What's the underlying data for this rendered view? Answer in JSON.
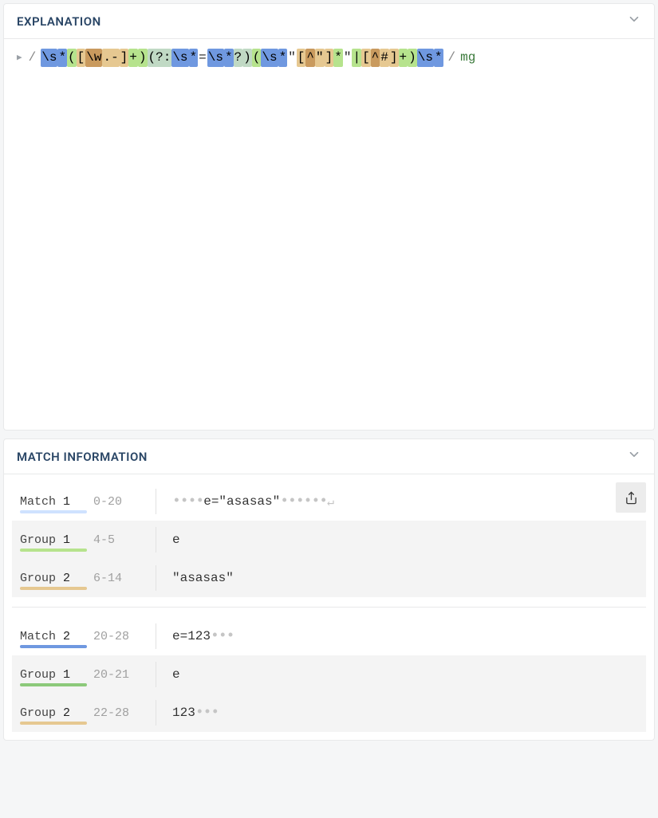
{
  "explanation": {
    "title": "EXPLANATION",
    "delimiter": "/",
    "flags": "mg",
    "tokens": [
      {
        "txt": "\\s",
        "cls": "c-blue"
      },
      {
        "txt": "*",
        "cls": "c-blue"
      },
      {
        "txt": "(",
        "cls": "c-lime"
      },
      {
        "txt": "[",
        "cls": "c-tan"
      },
      {
        "txt": "\\w",
        "cls": "c-brown"
      },
      {
        "txt": ".-",
        "cls": "c-tan"
      },
      {
        "txt": "]",
        "cls": "c-tan"
      },
      {
        "txt": "+",
        "cls": "c-lime"
      },
      {
        "txt": ")",
        "cls": "c-lime"
      },
      {
        "txt": "(?:",
        "cls": "c-slate"
      },
      {
        "txt": "\\s",
        "cls": "c-blue"
      },
      {
        "txt": "*",
        "cls": "c-blue"
      },
      {
        "txt": "=",
        "cls": "c-op"
      },
      {
        "txt": "\\s",
        "cls": "c-blue"
      },
      {
        "txt": "*",
        "cls": "c-blue"
      },
      {
        "txt": "?",
        "cls": "c-slate"
      },
      {
        "txt": ")",
        "cls": "c-slate"
      },
      {
        "txt": "(",
        "cls": "c-lime"
      },
      {
        "txt": "\\s",
        "cls": "c-blue"
      },
      {
        "txt": "*",
        "cls": "c-blue"
      },
      {
        "txt": "\"",
        "cls": "c-op"
      },
      {
        "txt": "[",
        "cls": "c-tan"
      },
      {
        "txt": "^",
        "cls": "c-brown"
      },
      {
        "txt": "\"",
        "cls": "c-tan"
      },
      {
        "txt": "]",
        "cls": "c-tan"
      },
      {
        "txt": "*",
        "cls": "c-lime"
      },
      {
        "txt": "\"",
        "cls": "c-op"
      },
      {
        "txt": "|",
        "cls": "c-lime"
      },
      {
        "txt": "[",
        "cls": "c-tan"
      },
      {
        "txt": "^",
        "cls": "c-brown"
      },
      {
        "txt": "#",
        "cls": "c-tan"
      },
      {
        "txt": "]",
        "cls": "c-tan"
      },
      {
        "txt": "+",
        "cls": "c-lime"
      },
      {
        "txt": ")",
        "cls": "c-lime"
      },
      {
        "txt": "\\s",
        "cls": "c-blue"
      },
      {
        "txt": "*",
        "cls": "c-blue"
      }
    ]
  },
  "matchInfo": {
    "title": "MATCH INFORMATION",
    "matches": [
      {
        "name": "Match",
        "index": "1",
        "range": "0-20",
        "underlineClass": "u-match1",
        "content": {
          "pre_dots": "••••",
          "text": "e=\"asasas\"",
          "post_dots": "••••••",
          "newline": "↵",
          "trailing_dots": ""
        },
        "groups": [
          {
            "name": "Group",
            "index": "1",
            "range": "4-5",
            "underlineClass": "u-g1-1",
            "content": {
              "pre_dots": "",
              "text": "e",
              "post_dots": "",
              "newline": "",
              "trailing_dots": ""
            }
          },
          {
            "name": "Group",
            "index": "2",
            "range": "6-14",
            "underlineClass": "u-g2",
            "content": {
              "pre_dots": "",
              "text": "\"asasas\"",
              "post_dots": "",
              "newline": "",
              "trailing_dots": ""
            }
          }
        ]
      },
      {
        "name": "Match",
        "index": "2",
        "range": "20-28",
        "underlineClass": "u-match2",
        "content": {
          "pre_dots": "",
          "text": "e=123",
          "post_dots": "",
          "newline": "",
          "trailing_dots": "•••"
        },
        "groups": [
          {
            "name": "Group",
            "index": "1",
            "range": "20-21",
            "underlineClass": "u-g1-2",
            "content": {
              "pre_dots": "",
              "text": "e",
              "post_dots": "",
              "newline": "",
              "trailing_dots": ""
            }
          },
          {
            "name": "Group",
            "index": "2",
            "range": "22-28",
            "underlineClass": "u-g2",
            "content": {
              "pre_dots": "",
              "text": "123",
              "post_dots": "",
              "newline": "",
              "trailing_dots": "•••"
            }
          }
        ]
      }
    ]
  }
}
